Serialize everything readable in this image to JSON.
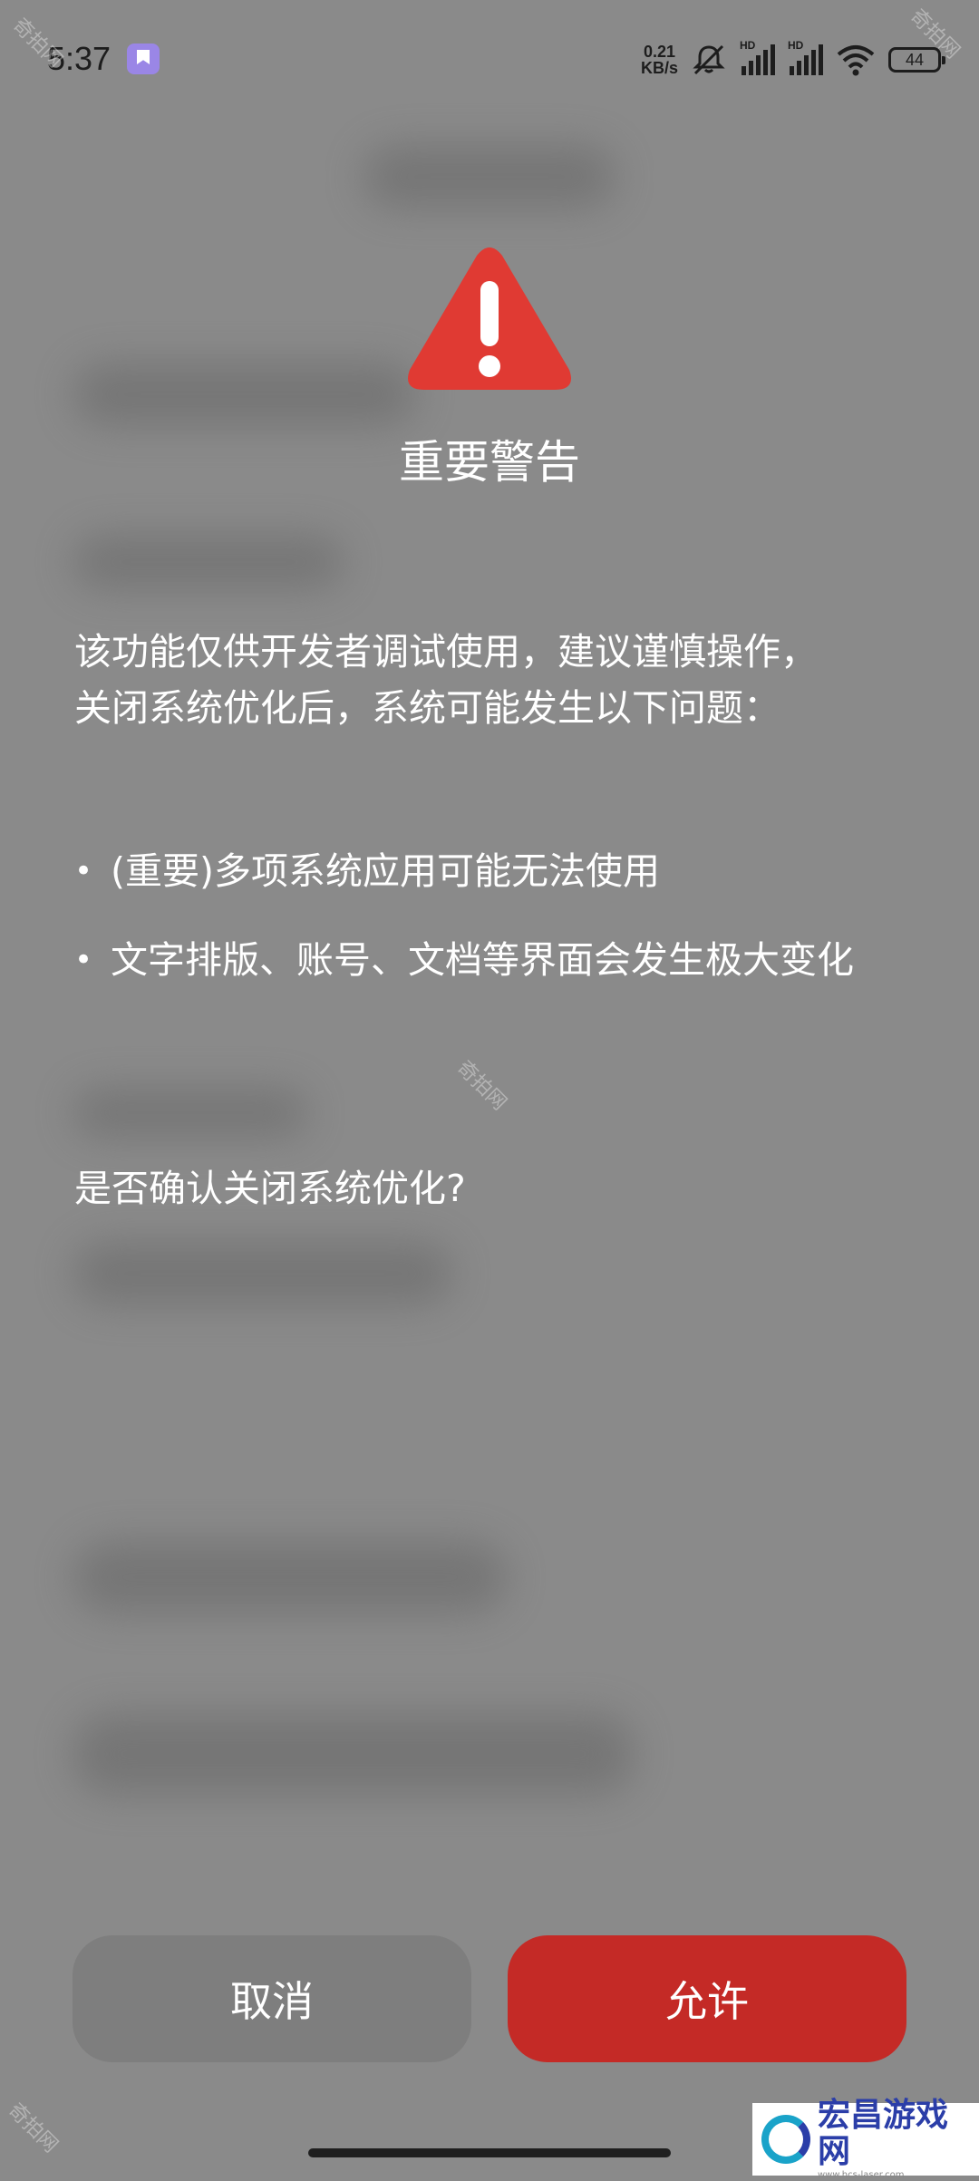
{
  "status_bar": {
    "time": "5:37",
    "net_speed_value": "0.21",
    "net_speed_unit": "KB/s",
    "hd_label_1": "HD",
    "hd_label_2": "HD",
    "battery": "44"
  },
  "dialog": {
    "icon": "warning-triangle-icon",
    "title": "重要警告",
    "message_lines": [
      "该功能仅供开发者调试使用，建议谨慎操作，",
      "关闭系统优化后，系统可能发生以下问题："
    ],
    "bullets": [
      "(重要)多项系统应用可能无法使用",
      "文字排版、账号、文档等界面会发生极大变化"
    ],
    "confirm_question": "是否确认关闭系统优化?",
    "cancel_label": "取消",
    "allow_label": "允许"
  },
  "watermarks": {
    "text": "奇拍网"
  },
  "site_logo": {
    "name": "宏昌游戏网",
    "url": "www.hcs-laser.com"
  },
  "colors": {
    "warning_red": "#e03a33",
    "allow_button": "#c42a26",
    "cancel_button": "#7e7e7e",
    "background": "#8a8a8a"
  }
}
